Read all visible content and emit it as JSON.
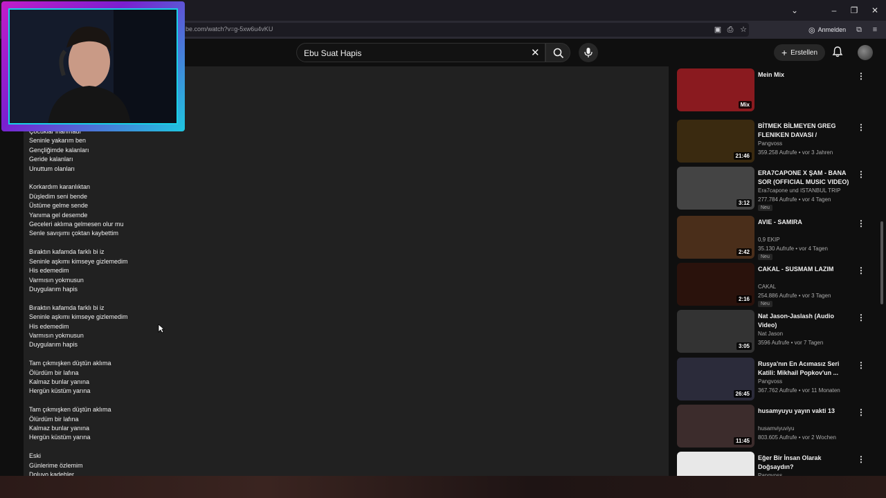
{
  "browser": {
    "url": "be.com/watch?v=g-5xw6u4vKU",
    "signin_label": "Anmelden"
  },
  "header": {
    "search_value": "Ebu Suat Hapis",
    "create_label": "Erstellen"
  },
  "lyrics": {
    "text": "Çocuklar inanmadı\nSeninle yakarım ben\nGençliğimde kalanları\nGeride kalanları\nUnuttum olanları\n\nKorkardım karanlıktan\nDüşledim seni bende\nÜstüme gelme sende\nYanıma gel desemde\nGeceleri aklıma gelmesen olur mu\nSenle savışımı çoktan kaybettim\n\nBıraktın kafamda farklı bi iz\nSeninle aşkımı kimseye gizlemedim\nHis edemedim\nVarmısın yokmusun\nDuygularım hapis\n\nBıraktın kafamda farklı bi iz\nSeninle aşkımı kimseye gizlemedim\nHis edemedim\nVarmısın yokmusun\nDuygularım hapis\n\nTam çıkmışken düştün aklıma\nÖlürdüm bir lafına\nKalmaz bunlar yanına\nHergün küstüm yarına\n\nTam çıkmışken düştün aklıma\nÖlürdüm bir lafına\nKalmaz bunlar yanına\nHergün küstüm yarına\n\nEski\nGünlerime özlemim\nDoluyo kadehler"
  },
  "recommendations": [
    {
      "title": "Mein Mix",
      "channel": "",
      "meta": "",
      "duration": "Mix",
      "thumb_color": "#8a1a1f",
      "new": false
    },
    {
      "title": "BİTMEK BİLMEYEN GREG FLENIKEN DAVASI / DEDEKTİF...",
      "channel": "Pangvoss",
      "meta": "359.258 Aufrufe • vor 3 Jahren",
      "duration": "21:46",
      "thumb_color": "#3a2a10",
      "new": false
    },
    {
      "title": "ERA7CAPONE X ŞAM - BANA SOR (OFFICIAL MUSIC VIDEO)",
      "channel": "Era7capone und ISTANBUL TRIP",
      "meta": "277.784 Aufrufe • vor 4 Tagen",
      "duration": "3:12",
      "thumb_color": "#444",
      "new": true
    },
    {
      "title": "AVIE - SAMIRA",
      "channel": "0,9 EKIP",
      "meta": "35.130 Aufrufe • vor 4 Tagen",
      "duration": "2:42",
      "thumb_color": "#4a2e1a",
      "new": true
    },
    {
      "title": "CAKAL - SUSMAM LAZIM",
      "channel": "CAKAL",
      "meta": "254.886 Aufrufe • vor 3 Tagen",
      "duration": "2:16",
      "thumb_color": "#2a120c",
      "new": true
    },
    {
      "title": "Nat Jason-Jaslash (Audio Video)",
      "channel": "Nat Jason",
      "meta": "3596 Aufrufe • vor 7 Tagen",
      "duration": "3:05",
      "thumb_color": "#333",
      "new": false
    },
    {
      "title": "Rusya'nın En Acımasız Seri Katili: Mikhail Popkov'un ...",
      "channel": "Pangvoss",
      "meta": "367.762 Aufrufe • vor 11 Monaten",
      "duration": "26:45",
      "thumb_color": "#2b2b3a",
      "new": false
    },
    {
      "title": "husamyuyu yayın vakti 13",
      "channel": "husamviyuviyu",
      "meta": "803.605 Aufrufe • vor 2 Wochen",
      "duration": "11:45",
      "thumb_color": "#3c2c2c",
      "new": false
    },
    {
      "title": "Eğer Bir İnsan Olarak Doğsaydın?",
      "channel": "Pangvoss",
      "meta": "",
      "duration": "",
      "thumb_color": "#e8e8e8",
      "new": false
    }
  ]
}
